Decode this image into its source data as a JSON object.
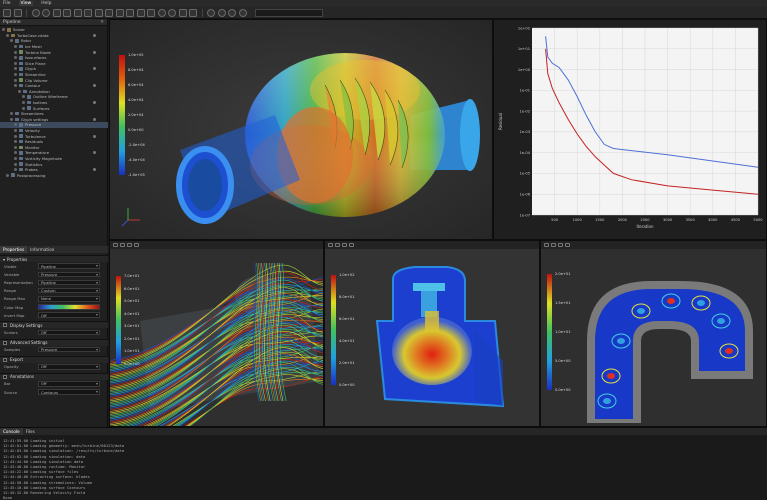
{
  "menu": [
    "File",
    "View",
    "Help"
  ],
  "pipeline": {
    "title": "Pipeline",
    "items": [
      {
        "label": "Solver",
        "sel": false
      },
      {
        "label": "TurboCase.cdata",
        "sel": false
      },
      {
        "label": "Rotor",
        "sel": false
      },
      {
        "label": "Ice Mesh",
        "sel": false
      },
      {
        "label": "Turbine Blade",
        "sel": false
      },
      {
        "label": "Isosurfaces",
        "sel": false
      },
      {
        "label": "Slice Plane",
        "sel": false
      },
      {
        "label": "Glyph",
        "sel": false
      },
      {
        "label": "Streamline",
        "sel": false
      },
      {
        "label": "Clip Volume",
        "sel": false
      },
      {
        "label": "Contour",
        "sel": false
      },
      {
        "label": "Annotation",
        "sel": false
      },
      {
        "label": "Outline Wireframe",
        "sel": false
      },
      {
        "label": "Isolines",
        "sel": false
      },
      {
        "label": "Surfaces",
        "sel": false
      },
      {
        "label": "Streamlines",
        "sel": false
      },
      {
        "label": "Glyph settings",
        "sel": false
      },
      {
        "label": "Pressure",
        "sel": true
      },
      {
        "label": "Velocity",
        "sel": false
      },
      {
        "label": "Turbulence",
        "sel": false
      },
      {
        "label": "Residuals",
        "sel": false
      },
      {
        "label": "Monitor",
        "sel": false
      },
      {
        "label": "Temperature",
        "sel": false
      },
      {
        "label": "Vorticity Magnitude",
        "sel": false
      },
      {
        "label": "Statistics",
        "sel": false
      },
      {
        "label": "Probes",
        "sel": false
      },
      {
        "label": "Postprocessing",
        "sel": false
      }
    ]
  },
  "properties": {
    "tabs": [
      "Properties",
      "Information"
    ],
    "section": "Properties",
    "rows": [
      {
        "label": "Visible",
        "value": "Pipeline"
      },
      {
        "label": "Variable",
        "value": "Pressure"
      },
      {
        "label": "Representation",
        "value": "Pipeline"
      },
      {
        "label": "Range",
        "value": "Custom"
      },
      {
        "label": "Range Max",
        "value": "None"
      },
      {
        "label": "Color Map",
        "value": ""
      },
      {
        "label": "Invert Map",
        "value": "Off"
      }
    ],
    "sections": [
      "Display Settings",
      "Advanced Settings",
      "Export",
      "Annotations"
    ],
    "extra_rows": [
      {
        "label": "Scalars",
        "value": "Off"
      },
      {
        "label": "Samples",
        "value": "Pressure"
      },
      {
        "label": "Opacity",
        "value": "Off"
      },
      {
        "label": "Bar",
        "value": "Off"
      },
      {
        "label": "Source",
        "value": "Contours"
      }
    ]
  },
  "main_view": {
    "colorbar_labels": [
      "1.0e+05",
      "8.0e+04",
      "6.0e+04",
      "4.0e+04",
      "2.0e+04",
      "0.0e+00",
      "-2.0e+04",
      "-4.0e+04",
      "-1.0e+05"
    ]
  },
  "residual_plot": {
    "ylabel": "Residual",
    "xlabel": "Iteration"
  },
  "chart_data": {
    "type": "line",
    "xlabel": "Iteration",
    "ylabel": "Residual",
    "log_y": true,
    "xlim": [
      0,
      5000
    ],
    "ylim_exp": [
      -7,
      2
    ],
    "x_ticks": [
      500,
      1000,
      1500,
      2000,
      2500,
      3000,
      3500,
      4000,
      4500,
      5000
    ],
    "y_ticks": [
      "1e+02",
      "1e+01",
      "1e+00",
      "1e-01",
      "1e-02",
      "1e-03",
      "1e-04",
      "1e-05",
      "1e-06",
      "1e-07"
    ],
    "series": [
      {
        "color": "#4e6fd8",
        "x": [
          300,
          350,
          450,
          600,
          800,
          1000,
          1200,
          1400,
          1600,
          1800,
          2200,
          3000,
          4000,
          5000
        ],
        "log10y": [
          1.6,
          0.6,
          0.3,
          0.1,
          -0.5,
          -1.3,
          -2.2,
          -3.0,
          -3.6,
          -3.8,
          -3.9,
          -4.1,
          -4.4,
          -4.7
        ]
      },
      {
        "color": "#c42222",
        "x": [
          300,
          350,
          450,
          600,
          800,
          1000,
          1200,
          1400,
          1600,
          1800,
          2200,
          3000,
          4000,
          5000
        ],
        "log10y": [
          1.0,
          -0.2,
          -0.9,
          -1.6,
          -2.4,
          -3.1,
          -3.7,
          -4.2,
          -4.6,
          -5.0,
          -5.3,
          -5.6,
          -5.8,
          -6.0
        ]
      }
    ]
  },
  "streamline_view": {
    "colorbar_labels": [
      "7.0e+01",
      "6.0e+01",
      "5.0e+01",
      "4.0e+01",
      "3.0e+01",
      "2.0e+01",
      "1.0e+01",
      "0.0e+00"
    ]
  },
  "section_view": {
    "colorbar_labels": [
      "1.0e+02",
      "8.0e+01",
      "6.0e+01",
      "4.0e+01",
      "2.0e+01",
      "0.0e+00"
    ]
  },
  "pipe_view": {
    "colorbar_labels": [
      "2.0e+01",
      "1.5e+01",
      "1.0e+01",
      "5.0e+00",
      "0.0e+00"
    ]
  },
  "console": {
    "tabs": [
      "Console",
      "Files"
    ],
    "lines": [
      "12:41:55.00  Loading initial",
      "12:42:01.00  Loading geometry: mesh/turbine/00123/data",
      "12:42:03.00  Loading simulation: /results/turbine/data",
      "12:43:02.00  Loading simulation: data",
      "12:43:44.00  Loading simulation data",
      "12:43:48.00  Loading runtime: Monitor",
      "12:44:22.00  Loading surface files",
      "12:44:40.00  Extracting surface: blades",
      "12:44:58.00  Loading streamlines: Volume",
      "12:45:10.00  Loading surface Contours",
      "12:45:32.00  Rendering Velocity Field",
      "Done"
    ]
  }
}
